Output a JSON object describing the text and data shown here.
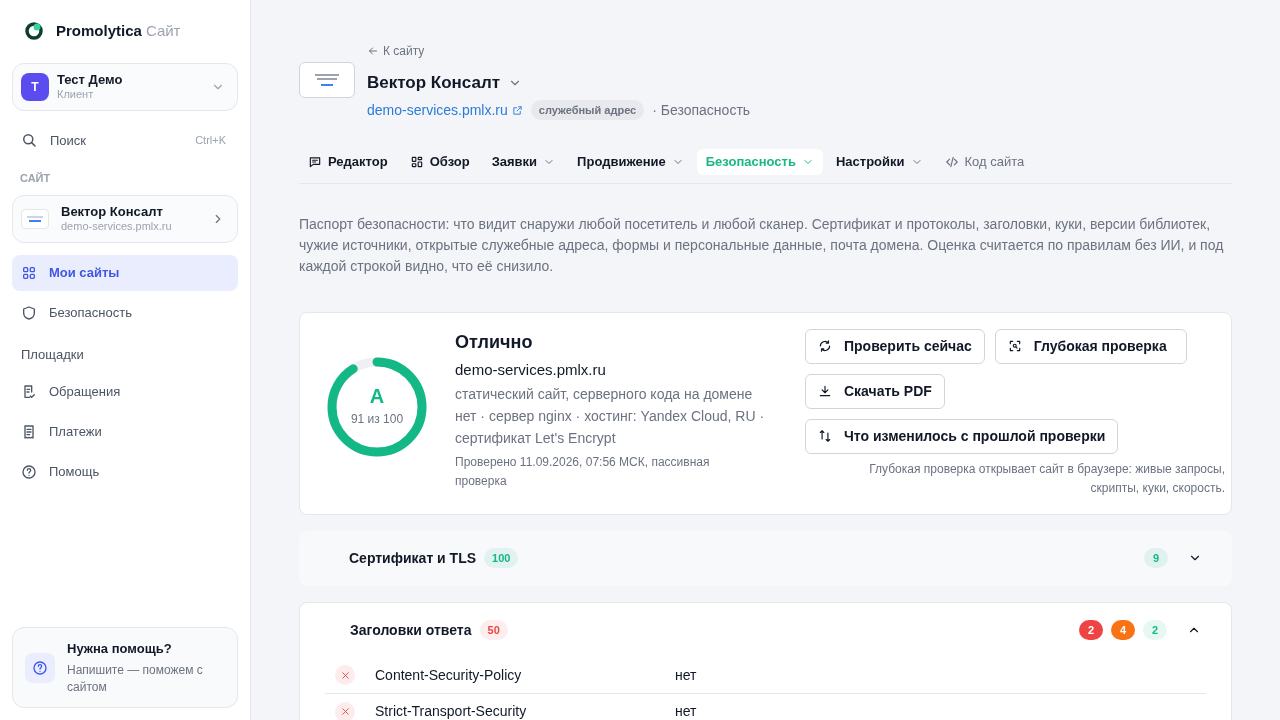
{
  "brand": {
    "name": "Promolytica",
    "suffix": "Сайт"
  },
  "account": {
    "initial": "Т",
    "name": "Тест Демо",
    "role": "Клиент"
  },
  "search": {
    "label": "Поиск",
    "shortcut": "Ctrl+K"
  },
  "site_section_label": "САЙТ",
  "site_card": {
    "name": "Вектор Консалт",
    "domain": "demo-services.pmlx.ru"
  },
  "nav": [
    {
      "kind": "grid",
      "label": "Мои сайты",
      "selected": true
    },
    {
      "kind": "shield",
      "label": "Безопасность",
      "selected": false
    },
    {
      "kind": "heading",
      "label": "Площадки",
      "selected": false
    },
    {
      "kind": "ticket",
      "label": "Обращения",
      "selected": false
    },
    {
      "kind": "receipt",
      "label": "Платежи",
      "selected": false
    },
    {
      "kind": "help",
      "label": "Помощь",
      "selected": false
    }
  ],
  "help_card": {
    "title": "Нужна помощь?",
    "text": "Напишите — поможем с сайтом"
  },
  "header": {
    "back": "К сайту",
    "title": "Вектор Консалт",
    "domain": "demo-services.pmlx.ru",
    "tag": "служебный адрес",
    "crumb": "· Безопасность"
  },
  "tabs": [
    {
      "kind": "editor",
      "label": "Редактор",
      "dropdown": false,
      "selected": false
    },
    {
      "kind": "overview",
      "label": "Обзор",
      "dropdown": false,
      "selected": false
    },
    {
      "kind": "plain",
      "label": "Заявки",
      "dropdown": true,
      "selected": false
    },
    {
      "kind": "plain",
      "label": "Продвижение",
      "dropdown": true,
      "selected": false
    },
    {
      "kind": "plain",
      "label": "Безопасность",
      "dropdown": true,
      "selected": true
    },
    {
      "kind": "plain",
      "label": "Настройки",
      "dropdown": true,
      "selected": false
    },
    {
      "kind": "code",
      "label": "Код сайта",
      "dropdown": false,
      "selected": false
    }
  ],
  "intro": "Паспорт безопасности: что видит снаружи любой посетитель и любой сканер. Сертификат и протоколы, заголовки, куки, версии библиотек, чужие источники, открытые служебные адреса, формы и персональные данные, почта домена. Оценка считается по правилам без ИИ, и под каждой строкой видно, что её снизило.",
  "score": {
    "grade": "A",
    "points": "91 из 100",
    "level": 0.91,
    "verdict": "Отлично",
    "domain": "demo-services.pmlx.ru",
    "description": "статический сайт, серверного кода на домене нет · сервер nginx · хостинг: Yandex Cloud, RU · сертификат Let's Encrypt",
    "checked": "Проверено 11.09.2026, 07:56 МСК, пассивная проверка"
  },
  "actions": [
    {
      "kind": "refresh",
      "label": "Проверить сейчас"
    },
    {
      "kind": "scan",
      "label": "Глубокая проверка"
    },
    {
      "kind": "download",
      "label": "Скачать PDF"
    },
    {
      "kind": "diff",
      "label": "Что изменилось с прошлой проверки"
    }
  ],
  "actions_note": "Глубокая проверка открывает сайт в браузере: живые запросы, скрипты, куки, скорость.",
  "sections": [
    {
      "title": "Сертификат и TLS",
      "score": "100",
      "color": "#14b886",
      "expanded": false,
      "counts": [
        {
          "value": "9",
          "color": "#14b886"
        }
      ]
    },
    {
      "title": "Заголовки ответа",
      "score": "50",
      "color": "#ef4444",
      "expanded": true,
      "counts": [
        {
          "value": "2",
          "color": "#ef4444"
        },
        {
          "value": "4",
          "color": "#f97316"
        },
        {
          "value": "2",
          "color": "#14b886"
        }
      ],
      "rows": [
        {
          "failed": true,
          "name": "Content-Security-Policy",
          "value": "нет"
        },
        {
          "failed": true,
          "name": "Strict-Transport-Security",
          "value": "нет"
        }
      ]
    }
  ]
}
